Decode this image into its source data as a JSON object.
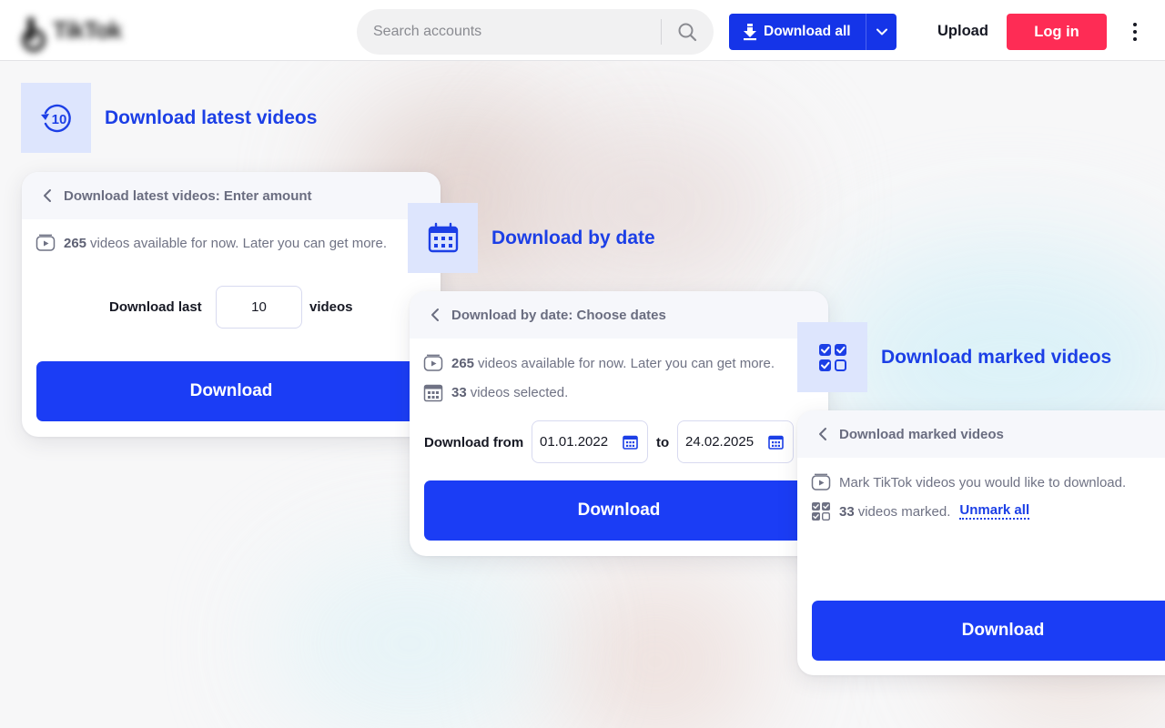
{
  "header": {
    "logo_text": "TikTok",
    "search_placeholder": "Search accounts",
    "download_all_label": "Download all",
    "upload_label": "Upload",
    "login_label": "Log in"
  },
  "sections": {
    "latest": {
      "title": "Download latest videos",
      "icon_number": "10",
      "card_header": "Download latest videos: Enter amount",
      "available_count": "265",
      "available_text": "videos available for now. Later you can get more.",
      "download_last_label": "Download last",
      "amount_value": "10",
      "videos_label": "videos",
      "download_button": "Download"
    },
    "by_date": {
      "title": "Download by date",
      "card_header": "Download by date: Choose dates",
      "available_count": "265",
      "available_text": "videos available for now. Later you can get more.",
      "selected_count": "33",
      "selected_text": "videos selected.",
      "from_label": "Download from",
      "from_date": "01.01.2022",
      "to_label": "to",
      "to_date": "24.02.2025",
      "download_button": "Download"
    },
    "marked": {
      "title": "Download marked videos",
      "card_header": "Download marked videos",
      "instruction": "Mark TikTok videos you would like to download.",
      "marked_count": "33",
      "marked_text": "videos marked.",
      "unmark_label": "Unmark all",
      "download_button": "Download"
    }
  },
  "colors": {
    "accent_blue": "#1b3df5",
    "title_blue": "#1c3fe6",
    "login_red": "#fe2c55",
    "icon_tile": "#dde5fd"
  }
}
